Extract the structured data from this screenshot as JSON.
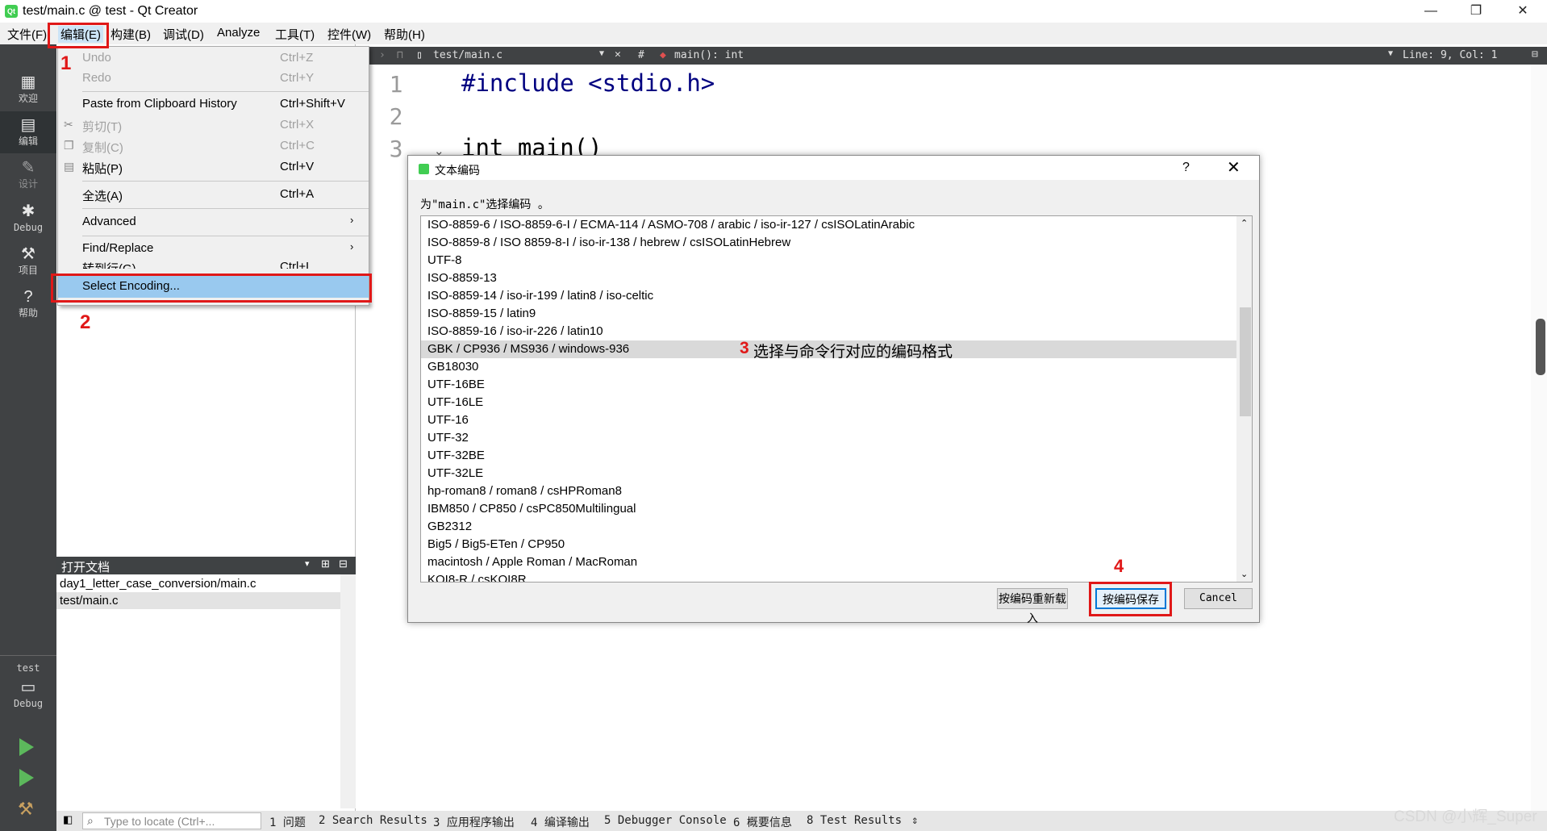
{
  "window": {
    "title": "test/main.c @ test - Qt Creator",
    "app_icon": "Qt",
    "minimize": "—",
    "maximize": "❐",
    "close": "✕"
  },
  "menubar": [
    "文件(F)",
    "编辑(E)",
    "构建(B)",
    "调试(D)",
    "Analyze",
    "工具(T)",
    "控件(W)",
    "帮助(H)"
  ],
  "sidebar": {
    "modes": [
      {
        "label": "欢迎",
        "icon": "grid-icon"
      },
      {
        "label": "编辑",
        "icon": "document-icon"
      },
      {
        "label": "设计",
        "icon": "pencil-icon"
      },
      {
        "label": "Debug",
        "icon": "bug-icon"
      },
      {
        "label": "项目",
        "icon": "wrench-icon"
      },
      {
        "label": "帮助",
        "icon": "help-icon"
      }
    ],
    "target": {
      "project": "test",
      "config": "Debug"
    }
  },
  "edit_menu": {
    "items": [
      {
        "label": "Undo",
        "shortcut": "Ctrl+Z",
        "disabled": true
      },
      {
        "label": "Redo",
        "shortcut": "Ctrl+Y",
        "disabled": true
      },
      {
        "label": "Paste from Clipboard History",
        "shortcut": "Ctrl+Shift+V",
        "disabled": false
      },
      {
        "label": "剪切(T)",
        "shortcut": "Ctrl+X",
        "disabled": true
      },
      {
        "label": "复制(C)",
        "shortcut": "Ctrl+C",
        "disabled": true
      },
      {
        "label": "粘贴(P)",
        "shortcut": "Ctrl+V",
        "disabled": false
      },
      {
        "label": "全选(A)",
        "shortcut": "Ctrl+A",
        "disabled": false
      },
      {
        "label": "Advanced",
        "shortcut": "",
        "disabled": false
      },
      {
        "label": "Find/Replace",
        "shortcut": "",
        "disabled": false
      },
      {
        "label": "转到行(G)...",
        "shortcut": "Ctrl+L",
        "disabled": false
      },
      {
        "label": "Select Encoding...",
        "shortcut": "",
        "disabled": false
      }
    ],
    "submenu_arrow": "›"
  },
  "open_documents": {
    "header": "打开文档",
    "items": [
      "day1_letter_case_conversion/main.c",
      "test/main.c"
    ],
    "selected_index": 1
  },
  "editor": {
    "file_tab": "test/main.c",
    "symbol_hash": "#",
    "symbol": "main(): int",
    "position": "Line: 9, Col: 1",
    "line_numbers": [
      "1",
      "2",
      "3"
    ],
    "code": [
      "#include <stdio.h>",
      "",
      "int main()"
    ]
  },
  "dialog": {
    "title": "文本编码",
    "help": "?",
    "close": "✕",
    "prompt": "为\"main.c\"选择编码 。",
    "encodings": [
      "ISO-8859-6 / ISO-8859-6-I / ECMA-114 / ASMO-708 / arabic / iso-ir-127 / csISOLatinArabic",
      "ISO-8859-8 / ISO 8859-8-I / iso-ir-138 / hebrew / csISOLatinHebrew",
      "UTF-8",
      "ISO-8859-13",
      "ISO-8859-14 / iso-ir-199 / latin8 / iso-celtic",
      "ISO-8859-15 / latin9",
      "ISO-8859-16 / iso-ir-226 / latin10",
      "GBK / CP936 / MS936 / windows-936",
      "GB18030",
      "UTF-16BE",
      "UTF-16LE",
      "UTF-16",
      "UTF-32",
      "UTF-32BE",
      "UTF-32LE",
      "hp-roman8 / roman8 / csHPRoman8",
      "IBM850 / CP850 / csPC850Multilingual",
      "GB2312",
      "Big5 / Big5-ETen / CP950",
      "macintosh / Apple Roman / MacRoman",
      "KOI8-R / csKOI8R"
    ],
    "selected_index": 7,
    "buttons": {
      "reload": "按编码重新载入",
      "save": "按编码保存",
      "cancel": "Cancel"
    }
  },
  "annotations": {
    "step1": "1",
    "step2": "2",
    "step3": "3",
    "step3_text": "选择与命令行对应的编码格式",
    "step4": "4",
    "color": "#e01818"
  },
  "statusbar": {
    "locate_placeholder": "Type to locate (Ctrl+...",
    "items": [
      "1 问题",
      "2 Search Results",
      "3 应用程序输出",
      "4 编译输出",
      "5 Debugger Console",
      "6 概要信息",
      "8 Test Results"
    ],
    "more": "⇕"
  },
  "watermark": "CSDN @小辉_Super"
}
